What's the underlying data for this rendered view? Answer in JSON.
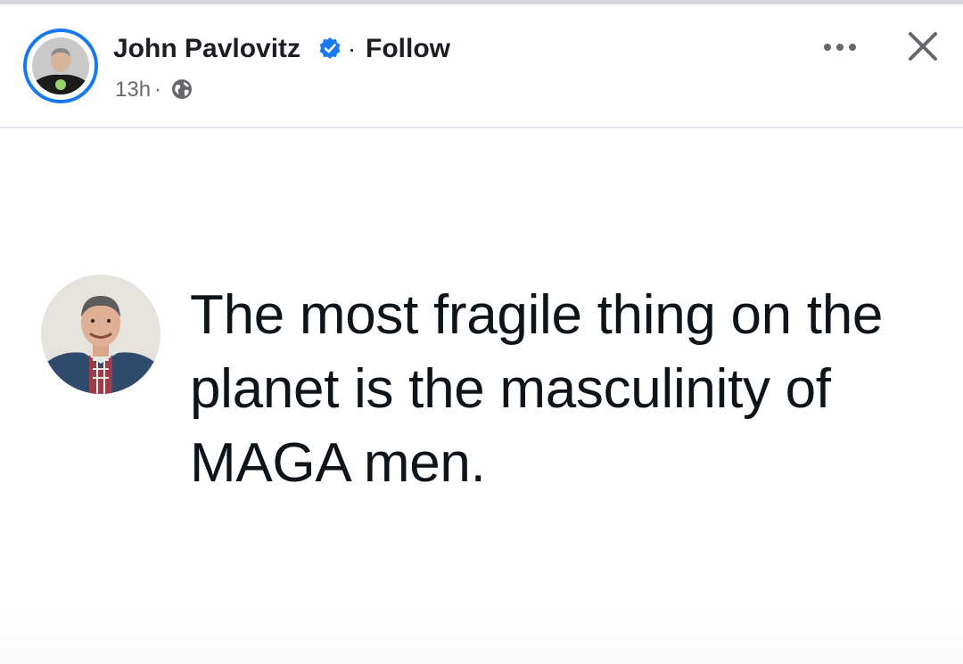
{
  "post": {
    "author": "John Pavlovitz",
    "separator": "·",
    "follow_label": "Follow",
    "timestamp": "13h",
    "meta_separator": "·",
    "privacy_icon": "globe-icon",
    "more_icon": "more-options-icon",
    "close_icon": "close-icon",
    "verified_icon": "verified-badge-icon"
  },
  "tweet": {
    "text": "The most fragile thing on the planet is the masculinity of MAGA men."
  },
  "colors": {
    "accent_blue": "#1877f2",
    "text_primary": "#1c1e21",
    "text_secondary": "#65676b",
    "tweet_text": "#0f1419",
    "divider": "#e4e6eb"
  }
}
